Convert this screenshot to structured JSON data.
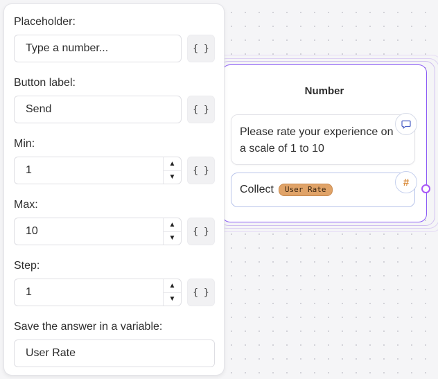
{
  "panel": {
    "placeholder": {
      "label": "Placeholder:",
      "value": "Type a number...",
      "var_btn": "{ }"
    },
    "button_label": {
      "label": "Button label:",
      "value": "Send",
      "var_btn": "{ }"
    },
    "min": {
      "label": "Min:",
      "value": "1",
      "var_btn": "{ }"
    },
    "max": {
      "label": "Max:",
      "value": "10",
      "var_btn": "{ }"
    },
    "step": {
      "label": "Step:",
      "value": "1",
      "var_btn": "{ }"
    },
    "save_variable": {
      "label": "Save the answer in a variable:",
      "value": "User Rate"
    }
  },
  "node": {
    "title": "Number",
    "text_block": {
      "text": "Please rate your experience on a scale of 1 to 10",
      "icon": "chat-bubble-icon"
    },
    "input_block": {
      "prefix": "Collect",
      "variable": "User Rate",
      "icon": "hash-icon",
      "icon_glyph": "#"
    }
  },
  "colors": {
    "node_border": "#8b5cf6",
    "handle": "#a855f7",
    "variable_tag": "#e0a368",
    "hash_icon": "#d98a3a"
  }
}
